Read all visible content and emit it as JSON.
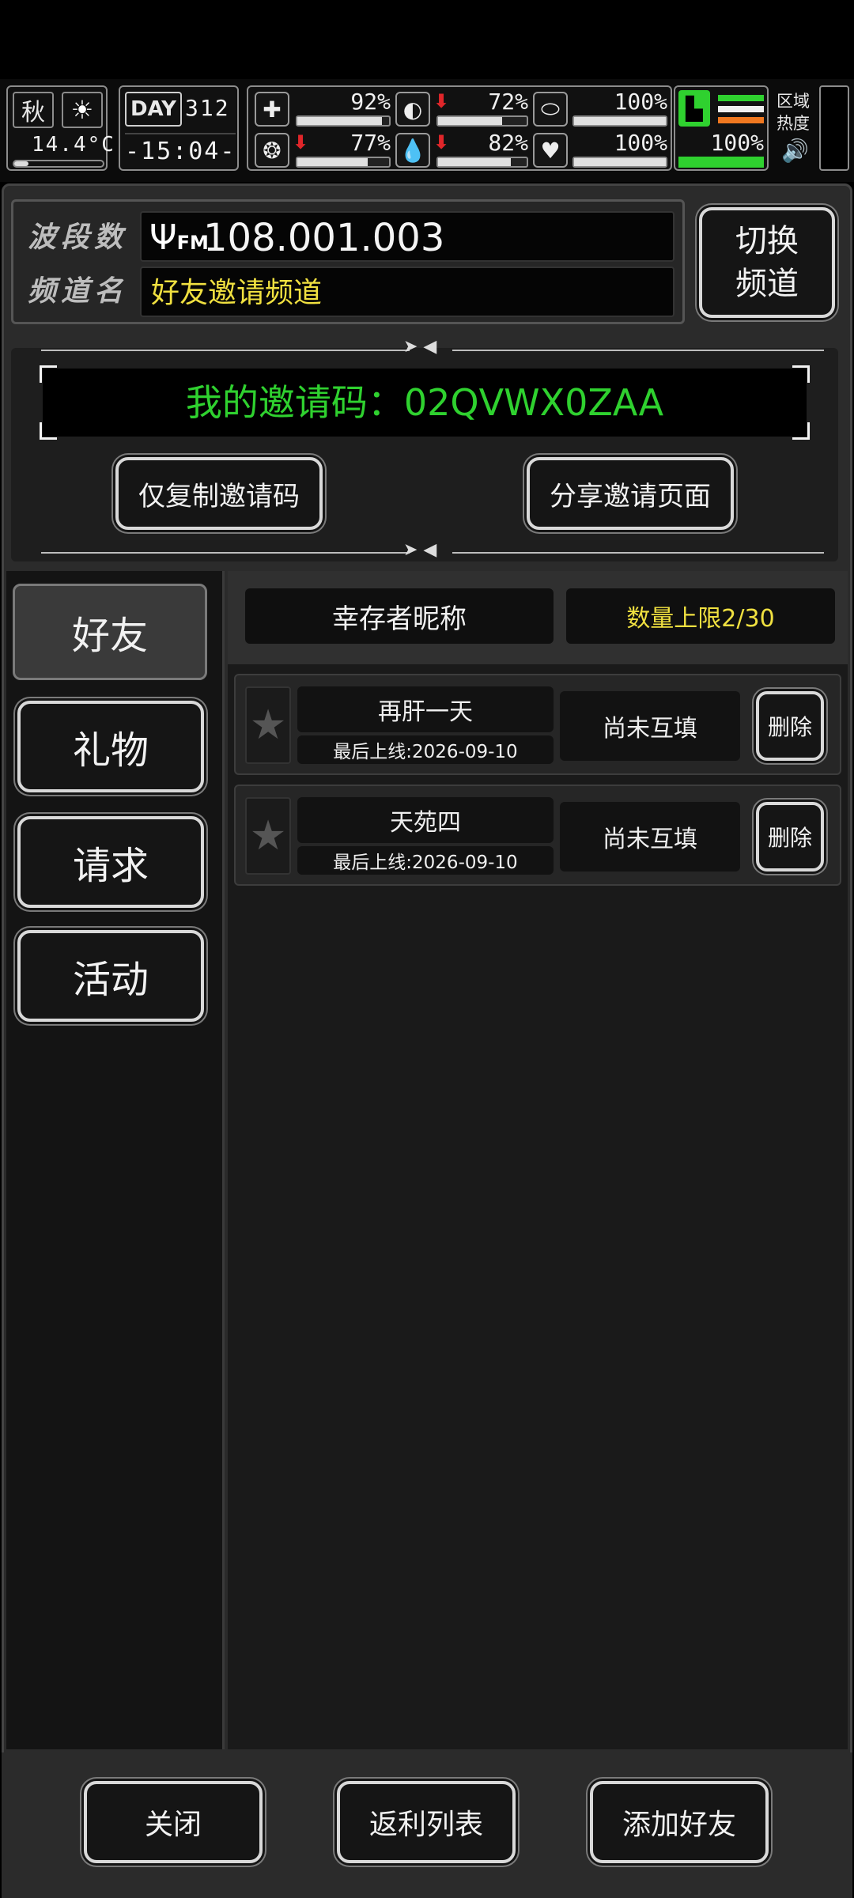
{
  "hud": {
    "season": "秋",
    "temperature": "14.4°C",
    "day_label": "DAY",
    "day_number": "312",
    "time": "-15:04-",
    "stats": [
      {
        "icon": "medkit-icon",
        "value": "92%",
        "fill": 0.92,
        "trend": ""
      },
      {
        "icon": "stomach-icon",
        "value": "72%",
        "fill": 0.72,
        "trend": "down"
      },
      {
        "icon": "pill-icon",
        "value": "100%",
        "fill": 1.0,
        "trend": ""
      },
      {
        "icon": "brain-icon",
        "value": "77%",
        "fill": 0.77,
        "trend": "down"
      },
      {
        "icon": "water-drop-icon",
        "value": "82%",
        "fill": 0.82,
        "trend": "down"
      },
      {
        "icon": "heart-icon",
        "value": "100%",
        "fill": 1.0,
        "trend": ""
      }
    ],
    "stamina": "100%",
    "stamina_fill": 1.0,
    "zone_heat": "区域热度"
  },
  "radio": {
    "band_label": "波段数",
    "band_icon_text": "FM",
    "band_value": "108.001.003",
    "channel_label": "频道名",
    "channel_value": "好友邀请频道",
    "switch_line1": "切换",
    "switch_line2": "频道"
  },
  "invite": {
    "code_text": "我的邀请码：02QVWX0ZAA",
    "copy_button": "仅复制邀请码",
    "share_button": "分享邀请页面"
  },
  "sidebar": {
    "items": [
      {
        "label": "好友",
        "active": true
      },
      {
        "label": "礼物",
        "active": false
      },
      {
        "label": "请求",
        "active": false
      },
      {
        "label": "活动",
        "active": false
      }
    ]
  },
  "friends": {
    "header_name": "幸存者昵称",
    "header_limit": "数量上限2/30",
    "rows": [
      {
        "name": "再肝一天",
        "last_online": "最后上线:2026-09-10",
        "status": "尚未互填",
        "delete": "删除"
      },
      {
        "name": "天苑四",
        "last_online": "最后上线:2026-09-10",
        "status": "尚未互填",
        "delete": "删除"
      }
    ]
  },
  "footer": {
    "close": "关闭",
    "rebate_list": "返利列表",
    "add_friend": "添加好友"
  },
  "colors": {
    "accent_green": "#2fd12f",
    "accent_yellow": "#f0e040",
    "alert_red": "#e0262a"
  }
}
